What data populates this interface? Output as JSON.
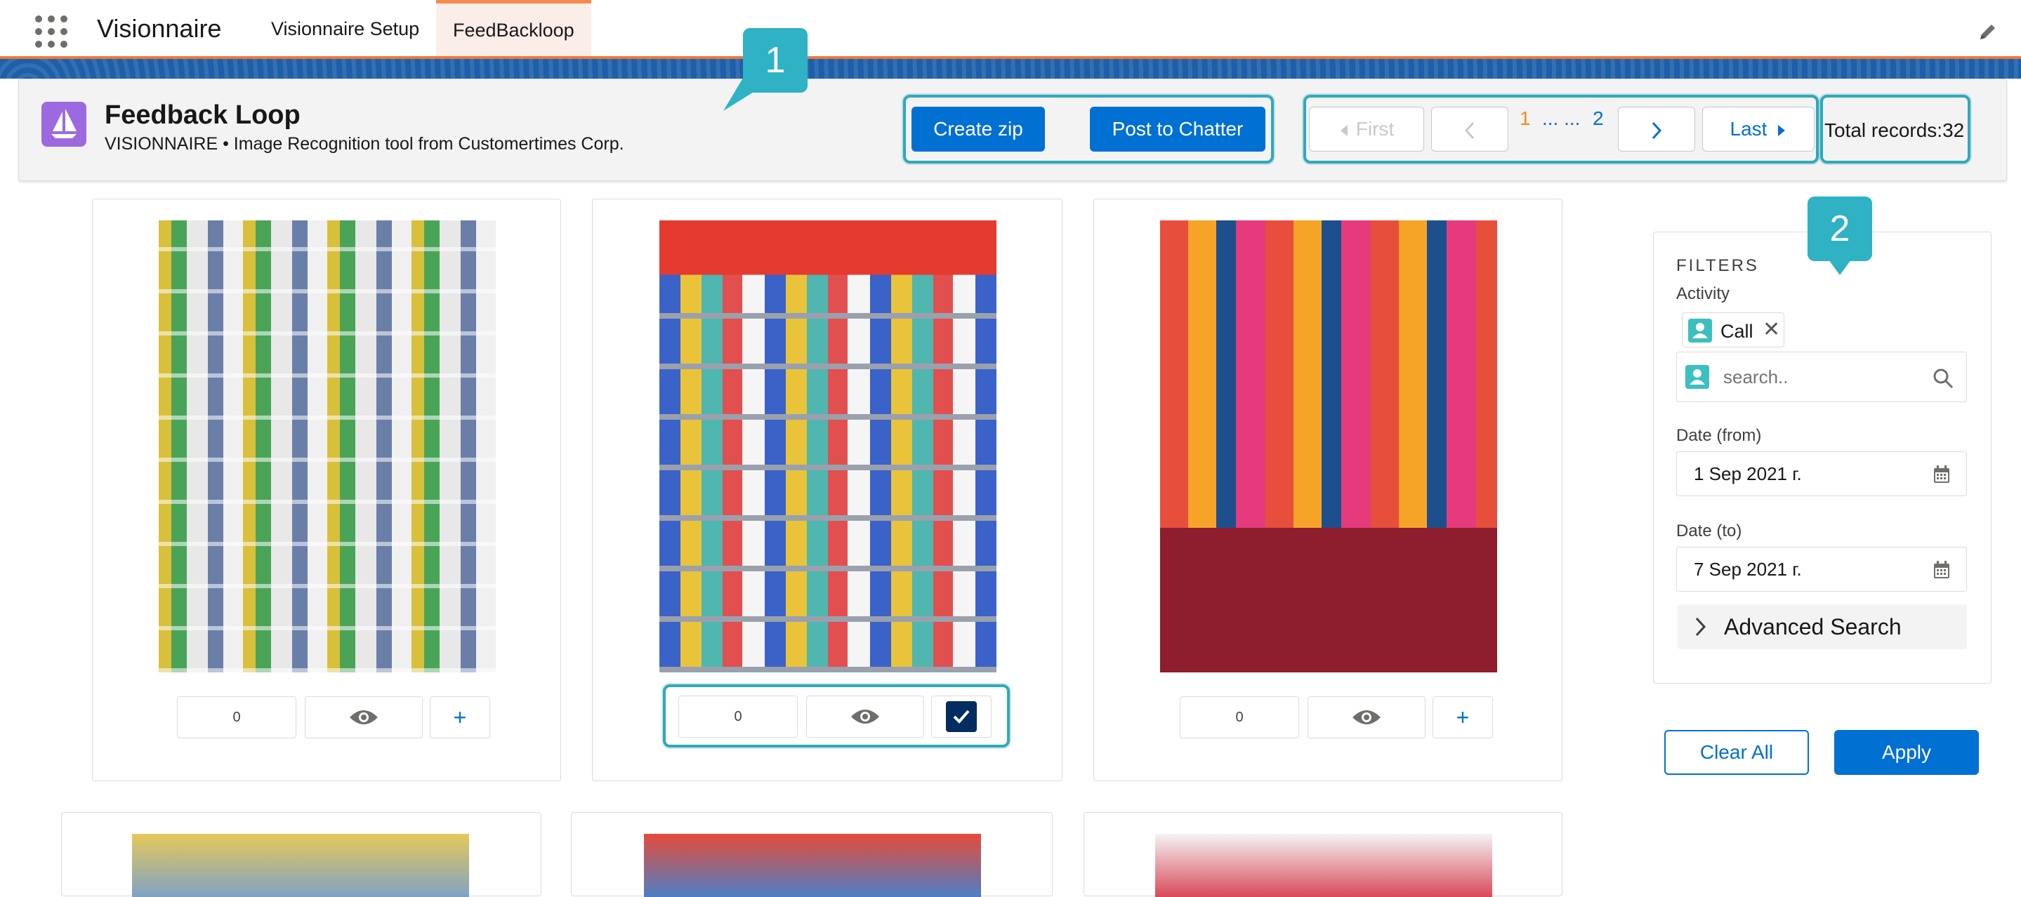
{
  "app": {
    "name": "Visionnaire",
    "tabs": [
      {
        "label": "Visionnaire Setup"
      },
      {
        "label": "FeedBackloop"
      }
    ]
  },
  "header": {
    "title": "Feedback Loop",
    "subtitle": "VISIONNAIRE • Image Recognition tool from Customertimes Corp.",
    "create_zip": "Create zip",
    "post_to_chatter": "Post to Chatter"
  },
  "pagination": {
    "first": "First",
    "current_page": "1",
    "ellipsis": "... ...",
    "page_2": "2",
    "last": "Last",
    "total": "Total records:32"
  },
  "callouts": {
    "one": "1",
    "two": "2"
  },
  "cards": [
    {
      "count": "0",
      "selected": false
    },
    {
      "count": "0",
      "selected": true
    },
    {
      "count": "0",
      "selected": false
    }
  ],
  "filters": {
    "title": "FILTERS",
    "activity_label": "Activity",
    "activity_pill": "Call",
    "search_placeholder": "search..",
    "date_from_label": "Date (from)",
    "date_from_value": "1 Sep 2021 г.",
    "date_to_label": "Date (to)",
    "date_to_value": "7 Sep 2021 г.",
    "advanced_search": "Advanced Search",
    "clear_all": "Clear All",
    "apply": "Apply"
  },
  "colors": {
    "brand_blue": "#0070d2",
    "highlight_teal": "#30a9b9",
    "callout_teal": "#2fb2c4",
    "accent_orange": "#f38b4f",
    "app_icon_purple": "#9c6ae0"
  }
}
